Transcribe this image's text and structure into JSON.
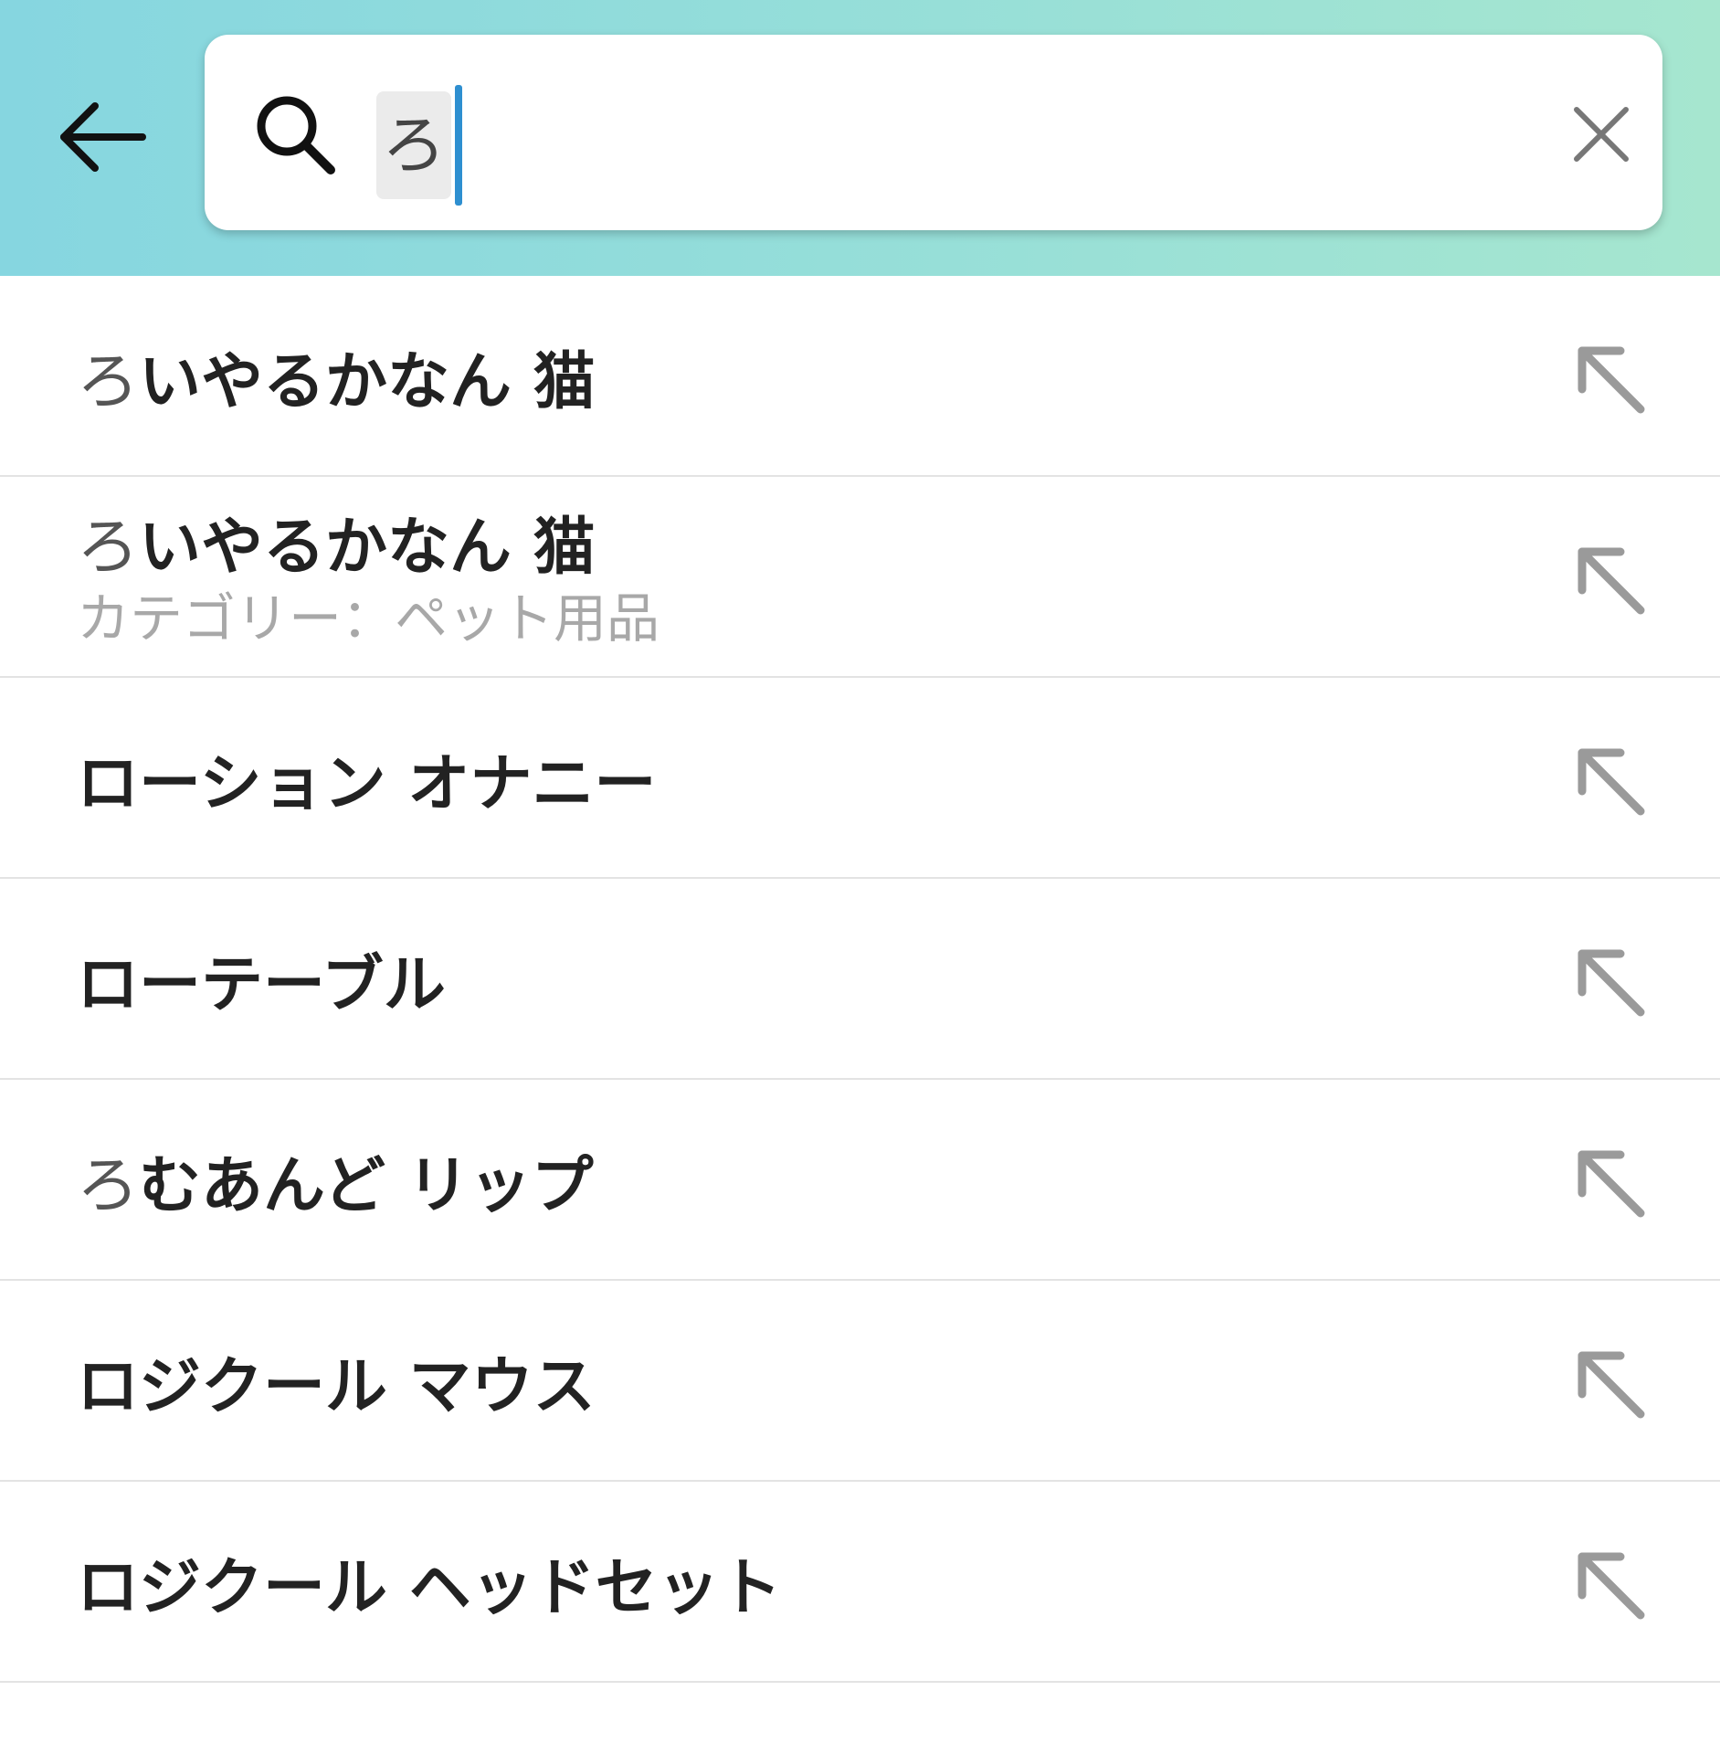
{
  "search": {
    "query": "ろ",
    "back_icon": "arrow-left-icon",
    "search_icon": "magnifier-icon",
    "clear_icon": "close-x-icon"
  },
  "suggestions": [
    {
      "prefix": "ろ",
      "rest": "いやるかなん 猫",
      "sub": ""
    },
    {
      "prefix": "ろ",
      "rest": "いやるかなん 猫",
      "sub": "カテゴリー：ペット用品"
    },
    {
      "prefix": "",
      "rest": "ローション オナニー",
      "sub": ""
    },
    {
      "prefix": "",
      "rest": "ローテーブル",
      "sub": ""
    },
    {
      "prefix": "ろ",
      "rest": "むあんど リップ",
      "sub": ""
    },
    {
      "prefix": "",
      "rest": "ロジクール マウス",
      "sub": ""
    },
    {
      "prefix": "",
      "rest": "ロジクール ヘッドセット",
      "sub": ""
    }
  ],
  "colors": {
    "header_gradient_start": "#86d6e0",
    "header_gradient_end": "#a6e6cf",
    "caret": "#2e8fd0",
    "arrow": "#9a9a9a"
  }
}
